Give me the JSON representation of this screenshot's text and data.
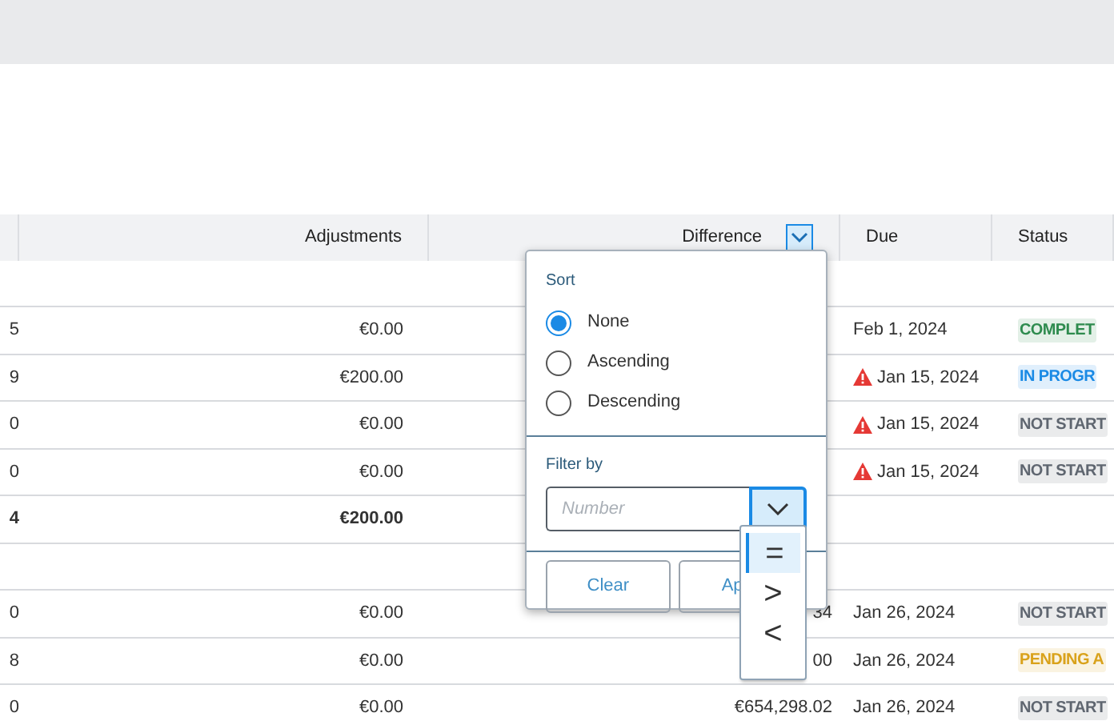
{
  "table": {
    "columns": [
      {
        "label": "Adjustments",
        "filter_open": false
      },
      {
        "label": "Difference",
        "filter_open": true
      },
      {
        "label": "Due",
        "filter_open": false
      },
      {
        "label": "Status",
        "filter_open": false
      }
    ],
    "rows": [
      {
        "kind": "group"
      },
      {
        "kind": "item",
        "column_1": "5",
        "adjustments": "€0.00",
        "due": "Feb 1, 2024",
        "overdue": false,
        "status": {
          "text": "COMPLET",
          "color": "#2e8b4e"
        }
      },
      {
        "kind": "item",
        "column_1": "9",
        "adjustments": "€200.00",
        "due": "Jan 15, 2024",
        "overdue": true,
        "status": {
          "text": "IN PROGR",
          "color": "#1a8ae5"
        }
      },
      {
        "kind": "item",
        "column_1": "0",
        "adjustments": "€0.00",
        "due": "Jan 15, 2024",
        "overdue": true,
        "status": {
          "text": "NOT START",
          "color": "#5f6670"
        }
      },
      {
        "kind": "item",
        "column_1": "0",
        "adjustments": "€0.00",
        "due": "Jan 15, 2024",
        "overdue": true,
        "status": {
          "text": "NOT START",
          "color": "#5f6670"
        }
      },
      {
        "kind": "subtotal",
        "column_1": "4",
        "adjustments": "€200.00"
      },
      {
        "kind": "group"
      },
      {
        "kind": "item",
        "column_1": "0",
        "adjustments": "€0.00",
        "difference": "34",
        "due": "Jan 26, 2024",
        "overdue": false,
        "status": {
          "text": "NOT START",
          "color": "#5f6670"
        }
      },
      {
        "kind": "item",
        "column_1": "8",
        "adjustments": "€0.00",
        "difference": "00",
        "due": "Jan 26, 2024",
        "overdue": false,
        "status": {
          "text": "PENDING A",
          "color": "#d9a21b"
        }
      },
      {
        "kind": "item",
        "column_1": "0",
        "adjustments": "€0.00",
        "difference": "€654,298.02",
        "due": "Jan 26, 2024",
        "overdue": false,
        "status": {
          "text": "NOT START",
          "color": "#5f6670"
        }
      }
    ]
  },
  "filter_popup": {
    "sort": {
      "label": "Sort",
      "options": [
        {
          "label": "None",
          "selected": true
        },
        {
          "label": "Ascending",
          "selected": false
        },
        {
          "label": "Descending",
          "selected": false
        }
      ]
    },
    "filter": {
      "label": "Filter by",
      "placeholder": "Number",
      "operators": [
        {
          "symbol": "=",
          "selected": true
        },
        {
          "symbol": ">",
          "selected": false
        },
        {
          "symbol": "<",
          "selected": false
        }
      ]
    },
    "buttons": [
      {
        "label": "Clear",
        "kind": "secondary"
      },
      {
        "label": "Ap",
        "kind": "primary"
      }
    ]
  }
}
